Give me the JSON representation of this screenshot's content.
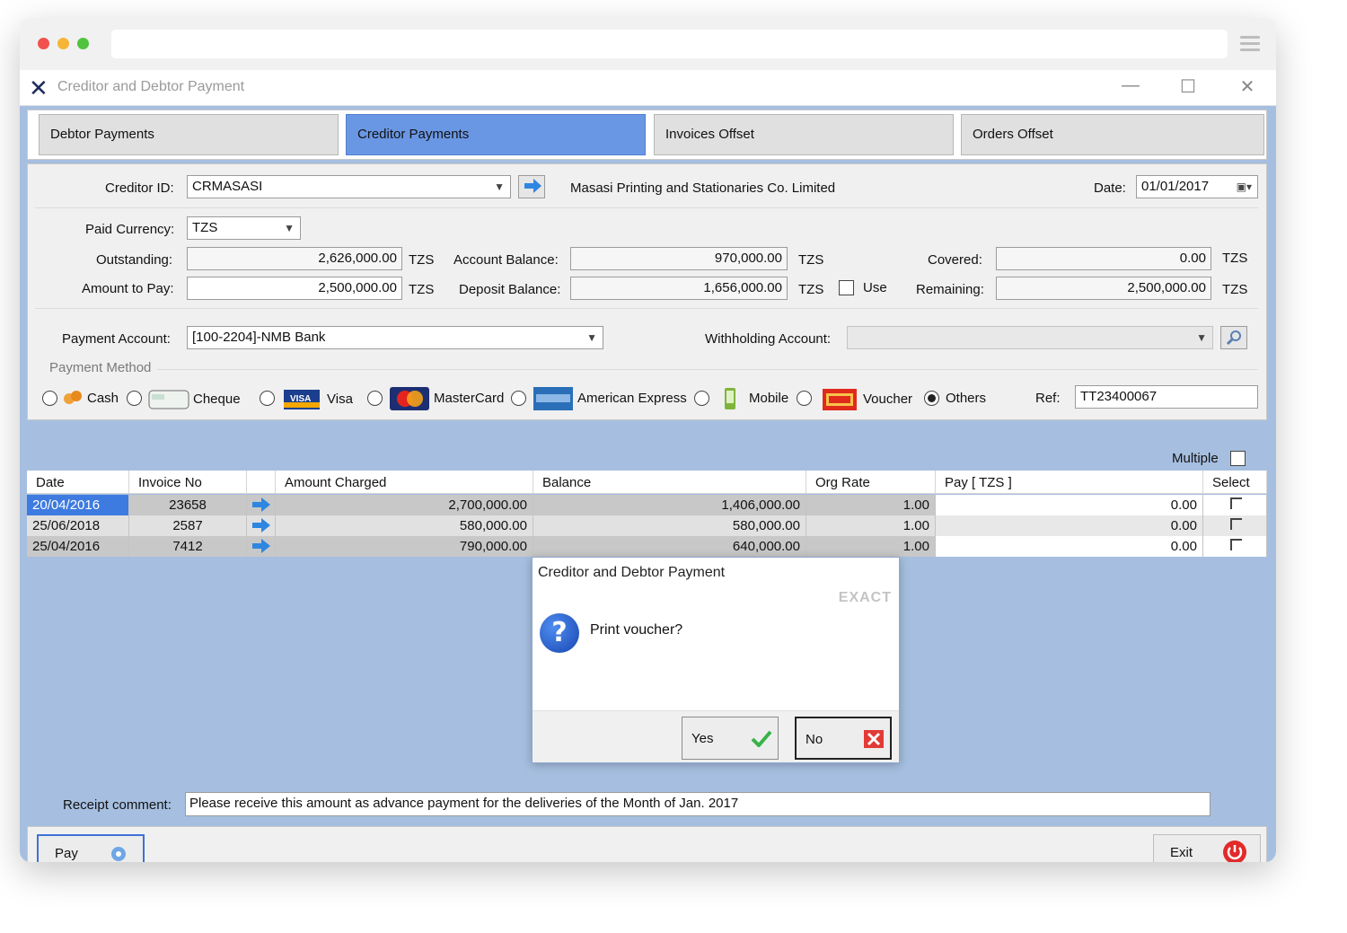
{
  "window": {
    "title": "Creditor and Debtor Payment",
    "controls": {
      "minimize": "—",
      "maximize": "☐",
      "close": "✕"
    }
  },
  "tabs": [
    {
      "label": "Debtor Payments",
      "active": false
    },
    {
      "label": "Creditor Payments",
      "active": true
    },
    {
      "label": "Invoices Offset",
      "active": false
    },
    {
      "label": "Orders Offset",
      "active": false
    }
  ],
  "form": {
    "creditor_id_label": "Creditor ID:",
    "creditor_id_value": "CRMASASI",
    "creditor_name": "Masasi Printing and Stationaries Co. Limited",
    "date_label": "Date:",
    "date_value": "01/01/2017",
    "paid_currency_label": "Paid Currency:",
    "paid_currency_value": "TZS",
    "outstanding_label": "Outstanding:",
    "outstanding_value": "2,626,000.00",
    "amount_to_pay_label": "Amount to Pay:",
    "amount_to_pay_value": "2,500,000.00",
    "account_balance_label": "Account Balance:",
    "account_balance_value": "970,000.00",
    "deposit_balance_label": "Deposit Balance:",
    "deposit_balance_value": "1,656,000.00",
    "use_label": "Use",
    "covered_label": "Covered:",
    "covered_value": "0.00",
    "remaining_label": "Remaining:",
    "remaining_value": "2,500,000.00",
    "currency_unit": "TZS",
    "payment_account_label": "Payment Account:",
    "payment_account_value": "[100-2204]-NMB Bank",
    "withholding_account_label": "Withholding Account:",
    "withholding_account_value": "",
    "payment_method_label": "Payment Method",
    "methods": [
      {
        "label": "Cash",
        "selected": false
      },
      {
        "label": "Cheque",
        "selected": false
      },
      {
        "label": "Visa",
        "selected": false
      },
      {
        "label": "MasterCard",
        "selected": false
      },
      {
        "label": "American Express",
        "selected": false
      },
      {
        "label": "Mobile",
        "selected": false
      },
      {
        "label": "Voucher",
        "selected": false
      },
      {
        "label": "Others",
        "selected": true
      }
    ],
    "ref_label": "Ref:",
    "ref_value": "TT23400067",
    "multiple_label": "Multiple"
  },
  "grid": {
    "columns": [
      "Date",
      "Invoice No",
      "",
      "Amount Charged",
      "Balance",
      "Org Rate",
      "Pay [ TZS ]",
      "Select"
    ],
    "rows": [
      {
        "date": "20/04/2016",
        "invoice": "23658",
        "amount": "2,700,000.00",
        "balance": "1,406,000.00",
        "rate": "1.00",
        "pay": "0.00"
      },
      {
        "date": "25/06/2018",
        "invoice": "2587",
        "amount": "580,000.00",
        "balance": "580,000.00",
        "rate": "1.00",
        "pay": "0.00"
      },
      {
        "date": "25/04/2016",
        "invoice": "7412",
        "amount": "790,000.00",
        "balance": "640,000.00",
        "rate": "1.00",
        "pay": "0.00"
      }
    ]
  },
  "dialog": {
    "title": "Creditor and Debtor Payment",
    "brand": "EXACT",
    "message": "Print voucher?",
    "yes_label": "Yes",
    "no_label": "No"
  },
  "footer": {
    "receipt_comment_label": "Receipt comment:",
    "receipt_comment_value": "Please receive this amount as advance payment for the deliveries of the Month of Jan. 2017",
    "pay_label": "Pay",
    "exit_label": "Exit"
  },
  "colors": {
    "app_background": "#a6bfe0",
    "active_tab": "#6a97e4",
    "selected_cell": "#3e7be0"
  }
}
